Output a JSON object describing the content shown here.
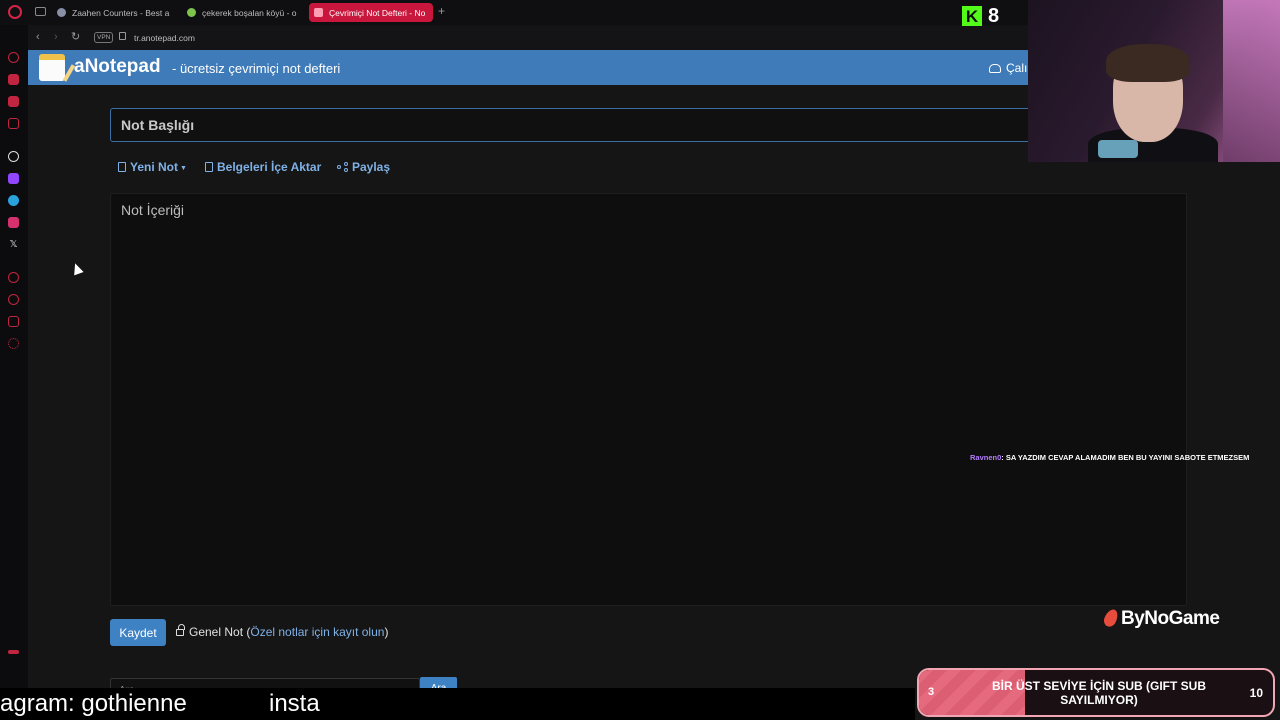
{
  "browser": {
    "tabs": [
      {
        "label": "Zaahen Counters - Best a",
        "icon_color": "#8a8fa8"
      },
      {
        "label": "çekerek boşalan köyü - o",
        "icon_color": "#7ec34a"
      },
      {
        "label": "Çevrimiçi Not Defteri - No",
        "icon_color": "#ff6b8a",
        "active": true
      }
    ],
    "new_tab": "+",
    "vpn": "VPN",
    "url": "tr.anotepad.com",
    "sidebar_icons": [
      "home-icon",
      "bag-icon",
      "shopping-icon",
      "news-icon",
      "chatgpt-icon",
      "twitch-icon",
      "telegram-icon",
      "instagram-icon",
      "x-icon",
      "record-icon",
      "history-icon",
      "pin-icon",
      "settings-icon",
      "more-icon"
    ]
  },
  "site": {
    "name": "aNotepad",
    "tagline": "- ücretsiz çevrimiçi not defteri",
    "workspace_label": "Çalış",
    "brand_color": "#3e7bb8"
  },
  "editor": {
    "title_placeholder": "Not Başlığı",
    "toolbar": {
      "new_note": "Yeni Not",
      "import_docs": "Belgeleri İçe Aktar",
      "share": "Paylaş"
    },
    "content_placeholder": "Not İçeriği",
    "save_label": "Kaydet",
    "public_note": "Genel Not",
    "public_note_open": " (",
    "private_notes_link": "Özel notlar için kayıt olun",
    "public_note_close": ")",
    "search_placeholder": "Ara",
    "search_button": "Ara"
  },
  "stream": {
    "kick_logo": "K",
    "viewer_count": "8",
    "chat": {
      "user": "Ravnen0",
      "message": ": SA YAZDIM CEVAP ALAMADIM BEN BU YAYINI SABOTE ETMEZSEM"
    },
    "sponsor": "ByNoGame",
    "sub_goal": {
      "text": "BİR ÜST SEVİYE İÇİN SUB (GIFT SUB SAYILMIYOR)",
      "current": "3",
      "target": "10",
      "progress": 0.3
    },
    "ticker": [
      "agram: gothienne",
      "insta"
    ]
  }
}
